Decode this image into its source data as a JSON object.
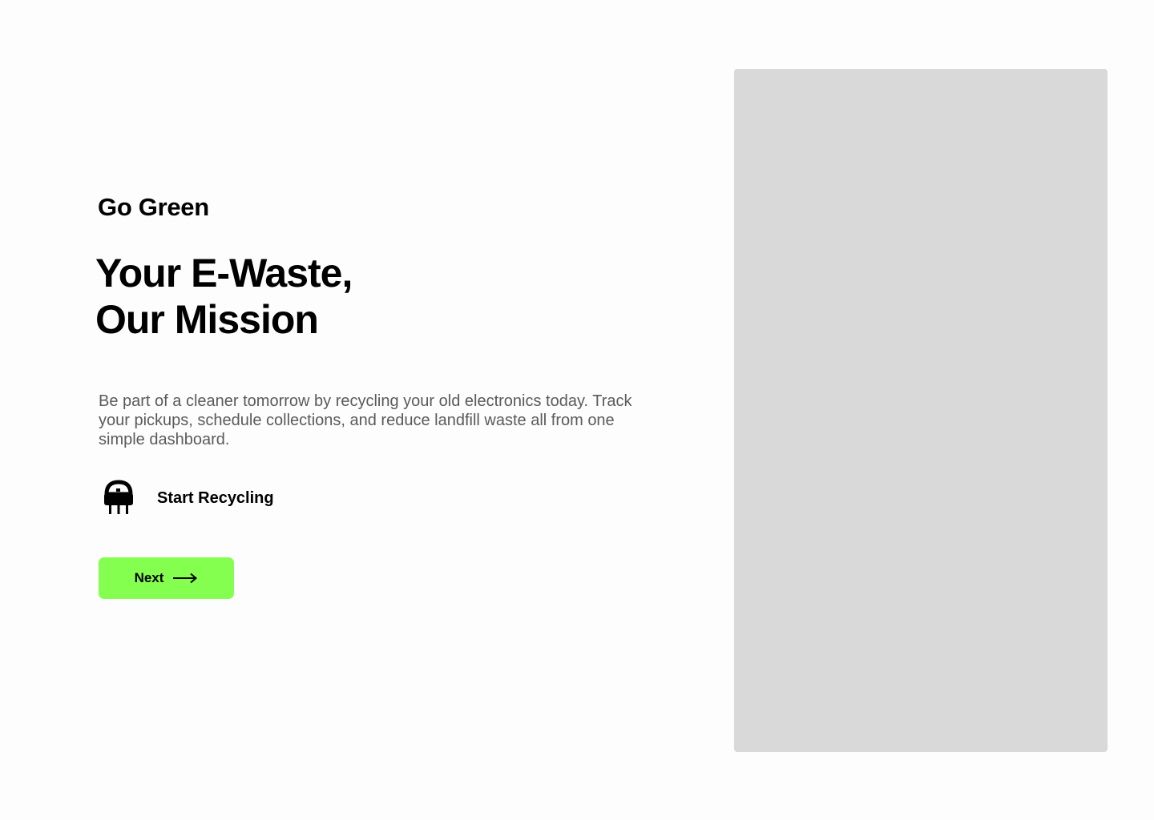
{
  "hero": {
    "brand": "Go Green",
    "headline_line1": "Your E-Waste,",
    "headline_line2": "Our Mission",
    "description": "Be part of a cleaner tomorrow by recycling your old electronics today. Track your pickups, schedule collections, and reduce landfill waste all from one simple dashboard.",
    "start_label": "Start Recycling",
    "start_icon": "chip-icon"
  },
  "actions": {
    "next_label": "Next",
    "next_icon": "arrow-right-icon",
    "accent_color": "#84ff4f"
  },
  "panel": {
    "color": "#d9d9d9"
  }
}
